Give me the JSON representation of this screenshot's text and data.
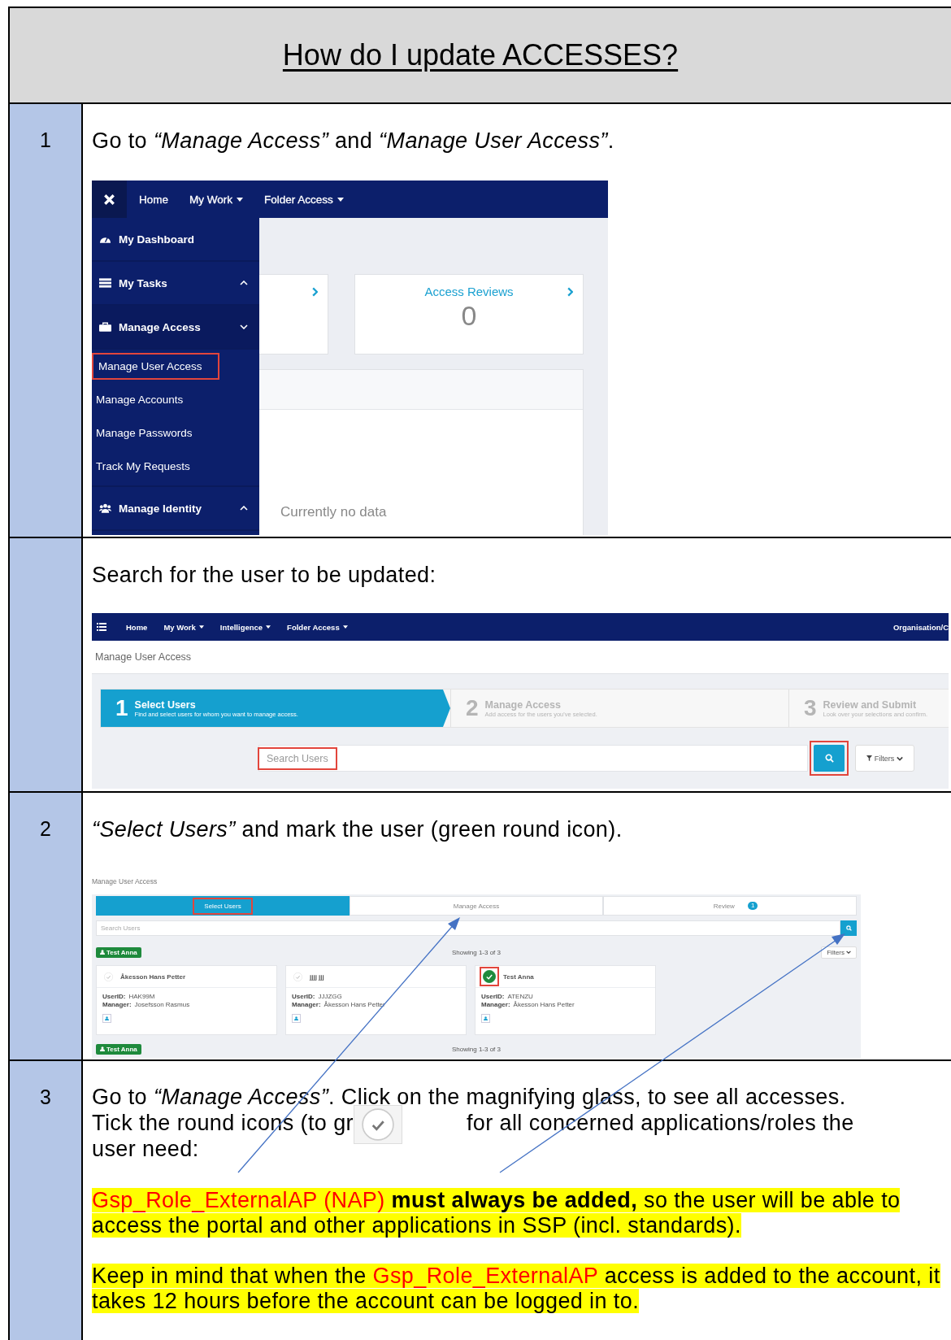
{
  "title": "How do I update ACCESSES?",
  "rows": [
    {
      "number": "1",
      "kind": "menu_screenshot",
      "instruction": "Go to *“Manage Access”* and *“Manage User Access”*.",
      "screen": {
        "nav": [
          {
            "label": "Home",
            "dropdown": false
          },
          {
            "label": "My Work",
            "dropdown": true
          },
          {
            "label": "Folder Access",
            "dropdown": true
          }
        ],
        "sidebar": [
          {
            "label": "My Dashboard"
          },
          {
            "label": "My Tasks",
            "expanded": false
          },
          {
            "label": "Manage Access",
            "expanded": true,
            "children": [
              {
                "label": "Manage User Access",
                "highlighted": true
              },
              {
                "label": "Manage Accounts",
                "highlighted": false
              },
              {
                "label": "Manage Passwords",
                "highlighted": false
              },
              {
                "label": "Track My Requests",
                "highlighted": false
              }
            ]
          },
          {
            "label": "Manage Identity",
            "expanded": false
          }
        ],
        "cards": [
          {
            "title": "Access Reviews",
            "value": "0"
          }
        ],
        "empty_text": "Currently no data"
      }
    },
    {
      "kind": "search_screenshot",
      "instruction": "Search for the user to be updated:",
      "screen": {
        "nav": [
          {
            "label": "Home",
            "dropdown": false
          },
          {
            "label": "My Work",
            "dropdown": true
          },
          {
            "label": "Intelligence",
            "dropdown": true
          },
          {
            "label": "Folder Access",
            "dropdown": true
          }
        ],
        "nav_right": "Organisation/C",
        "title": "Manage User Access",
        "steps": [
          {
            "number": "1",
            "title": "Select Users",
            "subtitle": "Find and select users for whom you want to manage access.",
            "selected": true
          },
          {
            "number": "2",
            "title": "Manage Access",
            "subtitle": "Add access for the users you've selected.",
            "selected": false
          },
          {
            "number": "3",
            "title": "Review and Submit",
            "subtitle": "Look over your selections and confirm.",
            "selected": false
          }
        ],
        "search": {
          "placeholder": "Search Users",
          "highlighted": true
        },
        "search_button": {
          "highlighted": true
        },
        "filters": "Filters"
      }
    },
    {
      "number": "2",
      "kind": "select_screenshot",
      "instruction": "*“Select Users”* and mark the user (green round icon).",
      "screen": {
        "title": "Manage User Access",
        "tabs": [
          {
            "label": "Select Users",
            "selected": true,
            "highlighted": true
          },
          {
            "label": "Manage Access",
            "selected": false,
            "highlighted": false
          },
          {
            "label": "Review",
            "selected": false,
            "highlighted": false,
            "badge": "1"
          }
        ],
        "search": {
          "placeholder": "Search Users"
        },
        "selected_user": "Test Anna",
        "showing": "Showing 1-3 of 3",
        "filters": "Filters",
        "users": [
          {
            "name": "Åkesson Hans Petter",
            "selected": false,
            "highlighted": false,
            "fields": [
              {
                "label": "UserID:",
                "value": "HAK99M"
              },
              {
                "label": "Manager:",
                "value": "Josefsson Rasmus"
              }
            ]
          },
          {
            "name": "jjjj jjj",
            "selected": false,
            "highlighted": false,
            "fields": [
              {
                "label": "UserID:",
                "value": "JJJZGG"
              },
              {
                "label": "Manager:",
                "value": "Åkesson Hans Petter"
              }
            ]
          },
          {
            "name": "Test Anna",
            "selected": true,
            "highlighted": true,
            "fields": [
              {
                "label": "UserID:",
                "value": "ATENZU"
              },
              {
                "label": "Manager:",
                "value": "Åkesson Hans Petter"
              }
            ]
          }
        ],
        "footer": {
          "selected_user": "Test Anna",
          "showing": "Showing 1-3 of 3"
        }
      }
    },
    {
      "number": "3",
      "kind": "notes",
      "instruction": "Go to *“Manage Access”*. Click on the magnifying glass, to see all accesses.",
      "tick_line": {
        "before": "Tick the round icons (to gr",
        "after": "for all concerned applications/roles the"
      },
      "tick_line_end": "user need:",
      "notes": [
        {
          "segments": [
            {
              "text": "Gsp_Role_ExternalAP (NAP)",
              "kind": "role"
            },
            {
              "text": "  must always be added,",
              "kind": "emphasis"
            },
            {
              "text": " so the user will be able to access the portal and other applications in SSP (incl. standards).",
              "kind": "text"
            }
          ]
        },
        {
          "segments": [
            {
              "text": "Keep in mind that when the ",
              "kind": "text"
            },
            {
              "text": "Gsp_Role_ExternalAP",
              "kind": "role"
            },
            {
              "text": " access is added to the account, it takes 12 hours before the account can be logged in to.",
              "kind": "text"
            }
          ]
        }
      ]
    }
  ]
}
